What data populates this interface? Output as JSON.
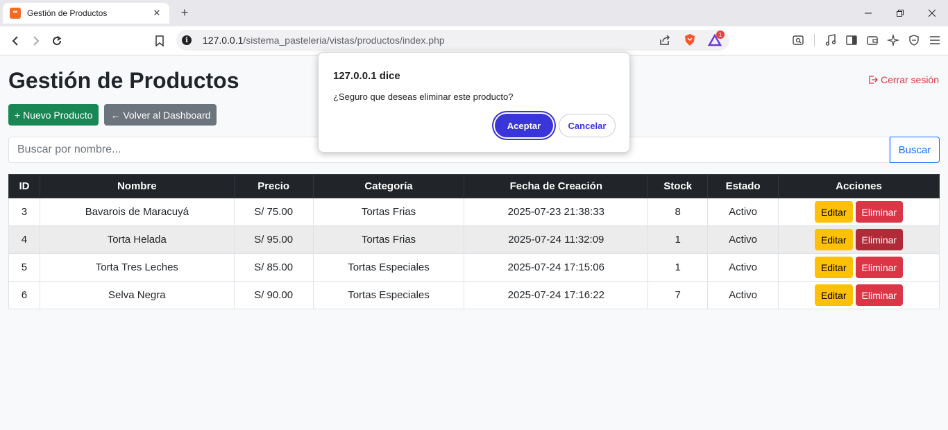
{
  "browser": {
    "tab_title": "Gestión de Productos",
    "url_host": "127.0.0.1",
    "url_path": "/sistema_pasteleria/vistas/productos/index.php",
    "shields_badge": "1"
  },
  "page": {
    "title": "Gestión de Productos",
    "logout_label": "Cerrar sesión",
    "new_product_label": "+ Nuevo Producto",
    "back_label": "← Volver al Dashboard",
    "search_placeholder": "Buscar por nombre...",
    "search_button": "Buscar"
  },
  "table": {
    "headers": [
      "ID",
      "Nombre",
      "Precio",
      "Categoría",
      "Fecha de Creación",
      "Stock",
      "Estado",
      "Acciones"
    ],
    "rows": [
      {
        "id": "3",
        "nombre": "Bavarois de Maracuyá",
        "precio": "S/ 75.00",
        "categoria": "Tortas Frias",
        "fecha": "2025-07-23 21:38:33",
        "stock": "8",
        "estado": "Activo"
      },
      {
        "id": "4",
        "nombre": "Torta Helada",
        "precio": "S/ 95.00",
        "categoria": "Tortas Frias",
        "fecha": "2025-07-24 11:32:09",
        "stock": "1",
        "estado": "Activo"
      },
      {
        "id": "5",
        "nombre": "Torta Tres Leches",
        "precio": "S/ 85.00",
        "categoria": "Tortas Especiales",
        "fecha": "2025-07-24 17:15:06",
        "stock": "1",
        "estado": "Activo"
      },
      {
        "id": "6",
        "nombre": "Selva Negra",
        "precio": "S/ 90.00",
        "categoria": "Tortas Especiales",
        "fecha": "2025-07-24 17:16:22",
        "stock": "7",
        "estado": "Activo"
      }
    ],
    "edit_label": "Editar",
    "delete_label": "Eliminar"
  },
  "dialog": {
    "title": "127.0.0.1 dice",
    "message": "¿Seguro que deseas eliminar este producto?",
    "ok_label": "Aceptar",
    "cancel_label": "Cancelar"
  },
  "colors": {
    "success": "#198754",
    "secondary": "#6c757d",
    "warning": "#ffc107",
    "danger": "#dc3545",
    "primary": "#0d6efd",
    "dialog_accent": "#3a35d8"
  }
}
